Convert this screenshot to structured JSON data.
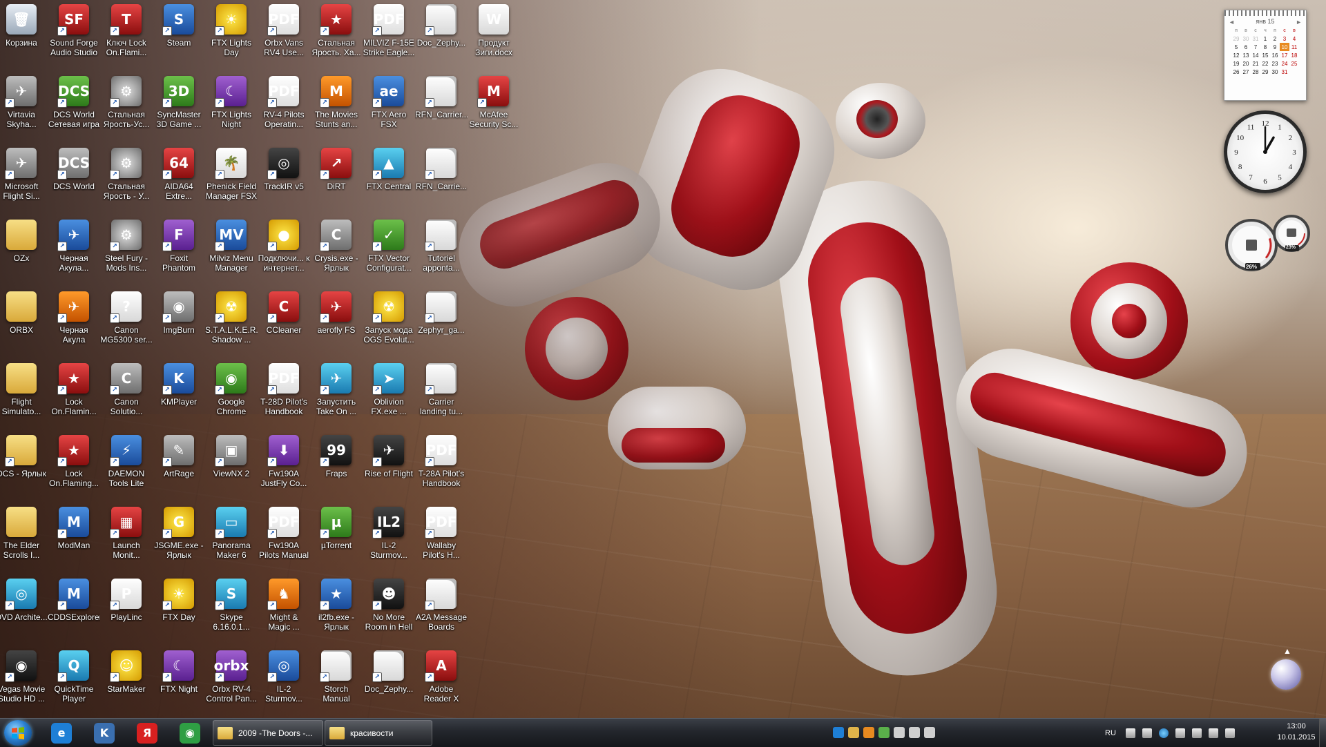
{
  "desktop": {
    "icons": [
      {
        "label": "Корзина",
        "icon": "recycle-bin-icon",
        "glyph": "🗑",
        "style": "t-trash",
        "shortcut": false
      },
      {
        "label": "Sound Forge Audio Studio",
        "icon": "sound-forge-icon",
        "glyph": "SF",
        "style": "t-red",
        "shortcut": true
      },
      {
        "label": "Ключ Lock On.Flami...",
        "icon": "lock-on-key-icon",
        "glyph": "T",
        "style": "t-red",
        "shortcut": true
      },
      {
        "label": "Steam",
        "icon": "steam-icon",
        "glyph": "S",
        "style": "t-blue",
        "shortcut": true
      },
      {
        "label": "FTX Lights Day",
        "icon": "ftx-lights-day-icon",
        "glyph": "☀",
        "style": "t-yellow",
        "shortcut": true
      },
      {
        "label": "Orbx Vans RV4 Use...",
        "icon": "pdf-icon",
        "glyph": "PDF",
        "style": "t-pdf",
        "shortcut": true
      },
      {
        "label": "Стальная Ярость. Ха...",
        "icon": "steel-fury-icon",
        "glyph": "★",
        "style": "t-red",
        "shortcut": true
      },
      {
        "label": "MILVIZ F-15E Strike Eagle...",
        "icon": "pdf-icon",
        "glyph": "PDF",
        "style": "t-pdf",
        "shortcut": true
      },
      {
        "label": "Doc_Zephy...",
        "icon": "document-icon",
        "glyph": "",
        "style": "t-doc",
        "shortcut": true
      },
      {
        "label": "Продукт Зиги.docx",
        "icon": "word-document-icon",
        "glyph": "W",
        "style": "t-doc",
        "shortcut": false
      },
      {
        "label": "Virtavia Skyha...",
        "icon": "virtavia-icon",
        "glyph": "✈",
        "style": "t-gray",
        "shortcut": true
      },
      {
        "label": "DCS World Сетевая игра",
        "icon": "dcs-world-icon",
        "glyph": "DCS",
        "style": "t-green",
        "shortcut": true
      },
      {
        "label": "Стальная Ярость-Ус...",
        "icon": "gear-icon",
        "glyph": "⚙",
        "style": "t-gear",
        "shortcut": true
      },
      {
        "label": "SyncMaster 3D Game ...",
        "icon": "syncmaster-icon",
        "glyph": "3D",
        "style": "t-green",
        "shortcut": true
      },
      {
        "label": "FTX Lights Night",
        "icon": "ftx-lights-night-icon",
        "glyph": "☾",
        "style": "t-purple",
        "shortcut": true
      },
      {
        "label": "RV-4 Pilots Operatin...",
        "icon": "pdf-icon",
        "glyph": "PDF",
        "style": "t-pdf",
        "shortcut": true
      },
      {
        "label": "The Movies Stunts an...",
        "icon": "the-movies-icon",
        "glyph": "M",
        "style": "t-orange",
        "shortcut": true
      },
      {
        "label": "FTX Aero FSX",
        "icon": "ftx-aero-icon",
        "glyph": "ae",
        "style": "t-blue",
        "shortcut": true
      },
      {
        "label": "RFN_Carrier...",
        "icon": "document-icon",
        "glyph": "",
        "style": "t-doc",
        "shortcut": true
      },
      {
        "label": "McAfee Security Sc...",
        "icon": "mcafee-icon",
        "glyph": "M",
        "style": "t-red",
        "shortcut": true
      },
      {
        "label": "Microsoft Flight Si...",
        "icon": "flight-simulator-icon",
        "glyph": "✈",
        "style": "t-gray",
        "shortcut": true
      },
      {
        "label": "DCS World",
        "icon": "dcs-world-icon",
        "glyph": "DCS",
        "style": "t-gray",
        "shortcut": true
      },
      {
        "label": "Стальная Ярость - У...",
        "icon": "gear-icon",
        "glyph": "⚙",
        "style": "t-gear",
        "shortcut": true
      },
      {
        "label": "AIDA64 Extre...",
        "icon": "aida64-icon",
        "glyph": "64",
        "style": "t-red",
        "shortcut": true
      },
      {
        "label": "Phenick Field Manager FSX",
        "icon": "field-manager-icon",
        "glyph": "🌴",
        "style": "t-doc",
        "shortcut": true
      },
      {
        "label": "TrackIR v5",
        "icon": "trackir-icon",
        "glyph": "◎",
        "style": "t-dark",
        "shortcut": true
      },
      {
        "label": "DiRT",
        "icon": "dirt-icon",
        "glyph": "↗",
        "style": "t-red",
        "shortcut": true
      },
      {
        "label": "FTX Central",
        "icon": "ftx-central-icon",
        "glyph": "▲",
        "style": "t-cyan",
        "shortcut": true
      },
      {
        "label": "RFN_Carrie...",
        "icon": "document-icon",
        "glyph": "",
        "style": "t-doc",
        "shortcut": true
      },
      {
        "label": "OZx",
        "icon": "folder-icon",
        "glyph": "",
        "style": "t-folder",
        "shortcut": false
      },
      {
        "label": "Черная Акула...",
        "icon": "black-shark-icon",
        "glyph": "✈",
        "style": "t-blue",
        "shortcut": true
      },
      {
        "label": "Steel Fury - Mods Ins...",
        "icon": "gear-icon",
        "glyph": "⚙",
        "style": "t-gear",
        "shortcut": true
      },
      {
        "label": "Foxit Phantom",
        "icon": "foxit-icon",
        "glyph": "F",
        "style": "t-purple",
        "shortcut": true
      },
      {
        "label": "Milviz Menu Manager",
        "icon": "milviz-icon",
        "glyph": "MV",
        "style": "t-blue",
        "shortcut": true
      },
      {
        "label": "Подключи... к интернет...",
        "icon": "beeline-icon",
        "glyph": "●",
        "style": "t-yellow",
        "shortcut": true
      },
      {
        "label": "Crysis.exe - Ярлык",
        "icon": "crysis-icon",
        "glyph": "C",
        "style": "t-gray",
        "shortcut": true
      },
      {
        "label": "FTX Vector Configurat...",
        "icon": "ftx-vector-icon",
        "glyph": "✓",
        "style": "t-green",
        "shortcut": true
      },
      {
        "label": "Tutoriel appontа...",
        "icon": "document-icon",
        "glyph": "",
        "style": "t-doc",
        "shortcut": true
      },
      {
        "label": "ORBX",
        "icon": "folder-icon",
        "glyph": "",
        "style": "t-folder",
        "shortcut": false
      },
      {
        "label": "Черная Акула",
        "icon": "black-shark-icon",
        "glyph": "✈",
        "style": "t-orange",
        "shortcut": true
      },
      {
        "label": "Canon MG5300 ser...",
        "icon": "canon-printer-icon",
        "glyph": "?",
        "style": "t-doc",
        "shortcut": true
      },
      {
        "label": "ImgBurn",
        "icon": "imgburn-icon",
        "glyph": "◉",
        "style": "t-gray",
        "shortcut": true
      },
      {
        "label": "S.T.A.L.K.E.R. Shadow ...",
        "icon": "radiation-icon",
        "glyph": "☢",
        "style": "t-yellow",
        "shortcut": true
      },
      {
        "label": "CCleaner",
        "icon": "ccleaner-icon",
        "glyph": "C",
        "style": "t-red",
        "shortcut": true
      },
      {
        "label": "aerofly FS",
        "icon": "aerofly-icon",
        "glyph": "✈",
        "style": "t-red",
        "shortcut": true
      },
      {
        "label": "Запуск мода OGS Evolut...",
        "icon": "radiation-icon",
        "glyph": "☢",
        "style": "t-yellow",
        "shortcut": true
      },
      {
        "label": "Zephyr_ga...",
        "icon": "document-icon",
        "glyph": "",
        "style": "t-doc",
        "shortcut": true
      },
      {
        "label": "Flight Simulato...",
        "icon": "folder-icon",
        "glyph": "",
        "style": "t-folder",
        "shortcut": false
      },
      {
        "label": "Lock On.Flamin...",
        "icon": "lock-on-icon",
        "glyph": "★",
        "style": "t-red",
        "shortcut": true
      },
      {
        "label": "Canon Solutio...",
        "icon": "canon-solution-icon",
        "glyph": "C",
        "style": "t-gray",
        "shortcut": true
      },
      {
        "label": "KMPlayer",
        "icon": "kmplayer-icon",
        "glyph": "K",
        "style": "t-blue",
        "shortcut": true
      },
      {
        "label": "Google Chrome",
        "icon": "chrome-icon",
        "glyph": "◉",
        "style": "t-green",
        "shortcut": true
      },
      {
        "label": "T-28D Pilot's Handbook",
        "icon": "pdf-icon",
        "glyph": "PDF",
        "style": "t-pdf",
        "shortcut": true
      },
      {
        "label": "Запустить Take On ...",
        "icon": "take-on-icon",
        "glyph": "✈",
        "style": "t-cyan",
        "shortcut": true
      },
      {
        "label": "Oblivion FX.exe ...",
        "icon": "oblivion-icon",
        "glyph": "➤",
        "style": "t-cyan",
        "shortcut": true
      },
      {
        "label": "Carrier landing tu...",
        "icon": "document-icon",
        "glyph": "",
        "style": "t-doc",
        "shortcut": true
      },
      {
        "label": "DCS - Ярлык",
        "icon": "folder-icon",
        "glyph": "",
        "style": "t-folder",
        "shortcut": true
      },
      {
        "label": "Lock On.Flaming...",
        "icon": "lock-on-icon",
        "glyph": "★",
        "style": "t-red",
        "shortcut": true
      },
      {
        "label": "DAEMON Tools Lite",
        "icon": "daemon-tools-icon",
        "glyph": "⚡",
        "style": "t-blue",
        "shortcut": true
      },
      {
        "label": "ArtRage",
        "icon": "artrage-icon",
        "glyph": "✎",
        "style": "t-gray",
        "shortcut": true
      },
      {
        "label": "ViewNX 2",
        "icon": "viewnx-icon",
        "glyph": "▣",
        "style": "t-gray",
        "shortcut": true
      },
      {
        "label": "Fw190A JustFly Co...",
        "icon": "installer-icon",
        "glyph": "⬇",
        "style": "t-purple",
        "shortcut": true
      },
      {
        "label": "Fraps",
        "icon": "fraps-icon",
        "glyph": "99",
        "style": "t-dark",
        "shortcut": true
      },
      {
        "label": "Rise of Flight",
        "icon": "rise-of-flight-icon",
        "glyph": "✈",
        "style": "t-dark",
        "shortcut": true
      },
      {
        "label": "T-28A Pilot's Handbook",
        "icon": "pdf-icon",
        "glyph": "PDF",
        "style": "t-pdf",
        "shortcut": true
      },
      {
        "label": "The Elder Scrolls I...",
        "icon": "folder-icon",
        "glyph": "",
        "style": "t-folder",
        "shortcut": false
      },
      {
        "label": "ModMan",
        "icon": "modman-icon",
        "glyph": "M",
        "style": "t-blue",
        "shortcut": true
      },
      {
        "label": "Launch Monit...",
        "icon": "launch-monitor-icon",
        "glyph": "▦",
        "style": "t-red",
        "shortcut": true
      },
      {
        "label": "JSGME.exe - Ярлык",
        "icon": "jsgme-icon",
        "glyph": "G",
        "style": "t-yellow",
        "shortcut": true
      },
      {
        "label": "Panorama Maker 6",
        "icon": "panorama-icon",
        "glyph": "▭",
        "style": "t-cyan",
        "shortcut": true
      },
      {
        "label": "Fw190A Pilots Manual",
        "icon": "pdf-icon",
        "glyph": "PDF",
        "style": "t-pdf",
        "shortcut": true
      },
      {
        "label": "µTorrent",
        "icon": "utorrent-icon",
        "glyph": "µ",
        "style": "t-green",
        "shortcut": true
      },
      {
        "label": "IL-2 Sturmov...",
        "icon": "il2-icon",
        "glyph": "IL2",
        "style": "t-dark",
        "shortcut": true
      },
      {
        "label": "Wallaby Pilot's H...",
        "icon": "pdf-icon",
        "glyph": "PDF",
        "style": "t-pdf",
        "shortcut": true
      },
      {
        "label": "DVD Archite...",
        "icon": "dvd-architect-icon",
        "glyph": "◎",
        "style": "t-cyan",
        "shortcut": true
      },
      {
        "label": "CDDSExplorer",
        "icon": "cddsexplorer-icon",
        "glyph": "M",
        "style": "t-blue",
        "shortcut": true
      },
      {
        "label": "PlayLinc",
        "icon": "playlinc-icon",
        "glyph": "P",
        "style": "t-doc",
        "shortcut": true
      },
      {
        "label": "FTX Day",
        "icon": "ftx-day-icon",
        "glyph": "☀",
        "style": "t-yellow",
        "shortcut": true
      },
      {
        "label": "Skype 6.16.0.1...",
        "icon": "skype-icon",
        "glyph": "S",
        "style": "t-cyan",
        "shortcut": true
      },
      {
        "label": "Might & Magic ...",
        "icon": "might-magic-icon",
        "glyph": "♞",
        "style": "t-orange",
        "shortcut": true
      },
      {
        "label": "il2fb.exe - Ярлык",
        "icon": "il2fb-icon",
        "glyph": "★",
        "style": "t-blue",
        "shortcut": true
      },
      {
        "label": "No More Room in Hell",
        "icon": "nmrih-icon",
        "glyph": "☻",
        "style": "t-dark",
        "shortcut": true
      },
      {
        "label": "A2A Message Boards",
        "icon": "document-icon",
        "glyph": "",
        "style": "t-doc",
        "shortcut": true
      },
      {
        "label": "Vegas Movie Studio HD ...",
        "icon": "vegas-icon",
        "glyph": "◉",
        "style": "t-dark",
        "shortcut": true
      },
      {
        "label": "QuickTime Player",
        "icon": "quicktime-icon",
        "glyph": "Q",
        "style": "t-cyan",
        "shortcut": true
      },
      {
        "label": "StarMaker",
        "icon": "starmaker-icon",
        "glyph": "☺",
        "style": "t-yellow",
        "shortcut": true
      },
      {
        "label": "FTX Night",
        "icon": "ftx-night-icon",
        "glyph": "☾",
        "style": "t-purple",
        "shortcut": true
      },
      {
        "label": "Orbx RV-4 Control Pan...",
        "icon": "orbx-icon",
        "glyph": "orbx",
        "style": "t-purple",
        "shortcut": true
      },
      {
        "label": "IL-2 Sturmov...",
        "icon": "il2-icon",
        "glyph": "◎",
        "style": "t-blue",
        "shortcut": true
      },
      {
        "label": "Storch Manual",
        "icon": "document-icon",
        "glyph": "",
        "style": "t-doc",
        "shortcut": true
      },
      {
        "label": "Doc_Zephy...",
        "icon": "document-icon",
        "glyph": "",
        "style": "t-doc",
        "shortcut": true
      },
      {
        "label": "Adobe Reader X",
        "icon": "adobe-reader-icon",
        "glyph": "A",
        "style": "t-red",
        "shortcut": true
      }
    ]
  },
  "gadgets": {
    "calendar": {
      "month": "янв 15",
      "prev": "◄",
      "next": "►",
      "weekdays": [
        "п",
        "в",
        "с",
        "ч",
        "п",
        "с",
        "в"
      ],
      "weeks": [
        [
          "29",
          "30",
          "31",
          "1",
          "2",
          "3",
          "4"
        ],
        [
          "5",
          "6",
          "7",
          "8",
          "9",
          "10",
          "11"
        ],
        [
          "12",
          "13",
          "14",
          "15",
          "16",
          "17",
          "18"
        ],
        [
          "19",
          "20",
          "21",
          "22",
          "23",
          "24",
          "25"
        ],
        [
          "26",
          "27",
          "28",
          "29",
          "30",
          "31",
          ""
        ]
      ],
      "today": "10",
      "time_hours": 13,
      "time_minutes": 0
    },
    "meter": {
      "cpu_percent": "26%",
      "memory_percent": "23%",
      "cpu_value": 0.26,
      "memory_value": 0.23
    },
    "clock_numbers": [
      "12",
      "1",
      "2",
      "3",
      "4",
      "5",
      "6",
      "7",
      "8",
      "9",
      "10",
      "11"
    ]
  },
  "taskbar": {
    "pinned": [
      {
        "name": "internet-explorer-icon",
        "glyph": "e",
        "color": "#1e7fd6"
      },
      {
        "name": "kmplayer-icon",
        "glyph": "K",
        "color": "#3a6fb0"
      },
      {
        "name": "yandex-browser-icon",
        "glyph": "Я",
        "color": "#d82020"
      },
      {
        "name": "chrome-icon",
        "glyph": "◉",
        "color": "#2f9e44"
      }
    ],
    "tasks": [
      {
        "label": "2009 -The Doors -..."
      },
      {
        "label": "красивости"
      }
    ],
    "language": "RU",
    "time": "13:00",
    "date": "10.01.2015"
  }
}
